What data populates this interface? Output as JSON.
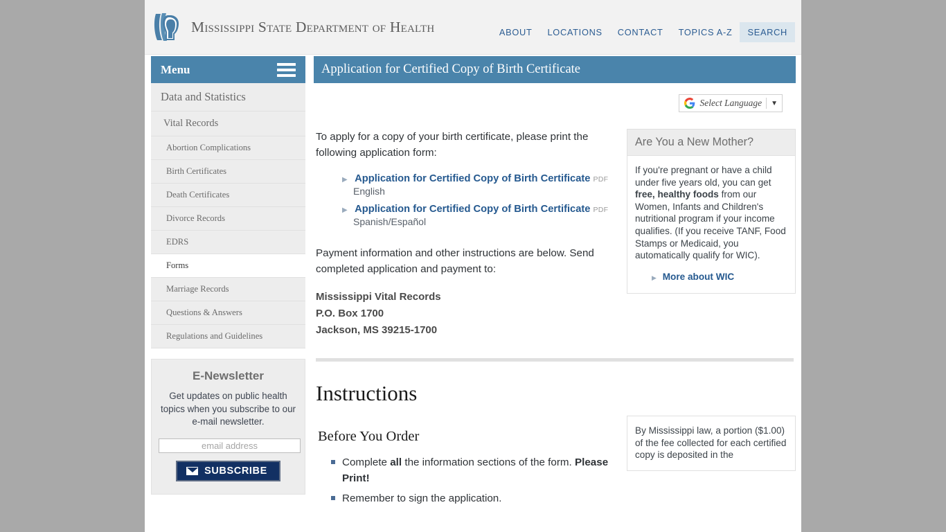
{
  "site": {
    "title": "Mississippi State Department of Health",
    "logo_icon": "msdh-profiles-logo"
  },
  "topnav": {
    "items": [
      {
        "label": "ABOUT",
        "active": false
      },
      {
        "label": "LOCATIONS",
        "active": false
      },
      {
        "label": "CONTACT",
        "active": false
      },
      {
        "label": "TOPICS A-Z",
        "active": false
      },
      {
        "label": "SEARCH",
        "active": true
      }
    ]
  },
  "sidebar": {
    "menu_label": "Menu",
    "hamburger_icon": "hamburger-menu-icon",
    "items": [
      {
        "label": "Data and Statistics",
        "level": 0,
        "active": false
      },
      {
        "label": "Vital Records",
        "level": 1,
        "active": false
      },
      {
        "label": "Abortion Complications",
        "level": 2,
        "active": false
      },
      {
        "label": "Birth Certificates",
        "level": 2,
        "active": false
      },
      {
        "label": "Death Certificates",
        "level": 2,
        "active": false
      },
      {
        "label": "Divorce Records",
        "level": 2,
        "active": false
      },
      {
        "label": "EDRS",
        "level": 2,
        "active": false
      },
      {
        "label": "Forms",
        "level": 2,
        "active": true
      },
      {
        "label": "Marriage Records",
        "level": 2,
        "active": false
      },
      {
        "label": "Questions & Answers",
        "level": 2,
        "active": false
      },
      {
        "label": "Regulations and Guidelines",
        "level": 2,
        "active": false
      }
    ]
  },
  "newsletter": {
    "heading": "E-Newsletter",
    "description": "Get updates on public health topics when you subscribe to our e-mail newsletter.",
    "email_placeholder": "email address",
    "email_value": "",
    "subscribe_label": "SUBSCRIBE",
    "envelope_icon": "envelope-icon"
  },
  "page": {
    "title": "Application for Certified Copy of Birth Certificate"
  },
  "language_widget": {
    "google_icon": "google-g-icon",
    "label": "Select Language",
    "caret_icon": "caret-down-icon"
  },
  "main": {
    "intro": "To apply for a copy of your birth certificate, please print the following application form:",
    "forms": [
      {
        "link_label": "Application for Certified Copy of Birth Certificate",
        "file_tag": "PDF",
        "sub_label": "English",
        "bullet_icon": "triangle-right-icon"
      },
      {
        "link_label": "Application for Certified Copy of Birth Certificate",
        "file_tag": "PDF",
        "sub_label": "Spanish/Español",
        "bullet_icon": "triangle-right-icon"
      }
    ],
    "payment_note": "Payment information and other instructions are below. Send completed application and payment to:",
    "address": [
      "Mississippi Vital Records",
      "P.O. Box 1700",
      "Jackson, MS 39215-1700"
    ],
    "instructions_heading": "Instructions",
    "before_order_heading": "Before You Order",
    "before_order_items": [
      {
        "text_before": "Complete ",
        "bold_1": "all",
        "text_middle": " the information sections of the form. ",
        "bold_2": "Please Print!"
      },
      {
        "text_before": "Remember to sign the application.",
        "bold_1": "",
        "text_middle": "",
        "bold_2": ""
      }
    ]
  },
  "new_mother_box": {
    "heading": "Are You a New Mother?",
    "body_part_1": "If you're pregnant or have a child under five years old, you can get ",
    "body_bold": "free, healthy foods",
    "body_part_2": " from our Women, Infants and Children's nutritional program if your income qualifies. (If you receive TANF, Food Stamps or Medicaid, you automatically qualify for WIC).",
    "link_label": "More about WIC",
    "bullet_icon": "triangle-right-icon"
  },
  "law_note_box": {
    "text": "By Mississippi law, a portion ($1.00) of the fee collected for each certified copy is deposited in the"
  },
  "colors": {
    "brand_blue": "#4a84ab",
    "link_blue": "#25598f",
    "nav_blue": "#2b5c92",
    "page_background": "#a9a9a9",
    "panel_gray": "#ededed",
    "subscribe_navy": "#123063"
  }
}
